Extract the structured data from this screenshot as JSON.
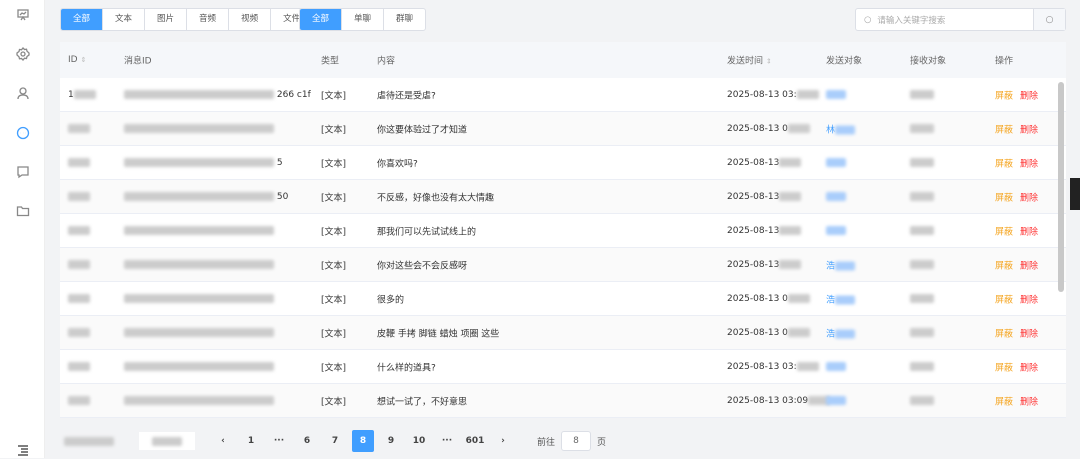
{
  "sidebar": {
    "icons": [
      "presentation-icon",
      "settings-icon",
      "user-icon",
      "chat-icon",
      "message-icon",
      "folder-icon",
      "menu-icon"
    ],
    "active": "chat-icon"
  },
  "filters": {
    "types": [
      "全部",
      "文本",
      "图片",
      "音频",
      "视频",
      "文件"
    ],
    "scopes": [
      "全部",
      "单聊",
      "群聊"
    ]
  },
  "search": {
    "placeholder": "请输入关键字搜索"
  },
  "table": {
    "headers": {
      "id": "ID",
      "msg_id": "消息ID",
      "type": "类型",
      "content": "内容",
      "time": "发送时间",
      "sender": "发送对象",
      "receiver": "接收对象",
      "actions": "操作"
    },
    "rows": [
      {
        "id": "1",
        "msg_id": "266 c1f",
        "type": "[文本]",
        "content": "虐待还是受虐?",
        "time": "2025-08-13 03:",
        "sender": "",
        "receiver": ""
      },
      {
        "id": "",
        "msg_id": "",
        "type": "[文本]",
        "content": "你这要体验过了才知道",
        "time": "2025-08-13 0",
        "sender": "林",
        "receiver": ""
      },
      {
        "id": "",
        "msg_id": "5",
        "type": "[文本]",
        "content": "你喜欢吗?",
        "time": "2025-08-13",
        "sender": "",
        "receiver": ""
      },
      {
        "id": "",
        "msg_id": "50",
        "type": "[文本]",
        "content": "不反感，好像也没有太大情趣",
        "time": "2025-08-13",
        "sender": "",
        "receiver": ""
      },
      {
        "id": "",
        "msg_id": "",
        "type": "[文本]",
        "content": "那我们可以先试试线上的",
        "time": "2025-08-13",
        "sender": "",
        "receiver": ""
      },
      {
        "id": "",
        "msg_id": "",
        "type": "[文本]",
        "content": "你对这些会不会反感呀",
        "time": "2025-08-13",
        "sender": "浩",
        "receiver": ""
      },
      {
        "id": "",
        "msg_id": "",
        "type": "[文本]",
        "content": "很多的",
        "time": "2025-08-13 0",
        "sender": "浩",
        "receiver": ""
      },
      {
        "id": "",
        "msg_id": "",
        "type": "[文本]",
        "content": "皮鞭 手拷 脚链 蜡烛 项圈 这些",
        "time": "2025-08-13 0",
        "sender": "浩",
        "receiver": ""
      },
      {
        "id": "",
        "msg_id": "",
        "type": "[文本]",
        "content": "什么样的道具?",
        "time": "2025-08-13 03:",
        "sender": "",
        "receiver": ""
      },
      {
        "id": "",
        "msg_id": "",
        "type": "[文本]",
        "content": "想试一试了，不好意思",
        "time": "2025-08-13 03:09",
        "sender": "",
        "receiver": ""
      }
    ],
    "action_block": "屏蔽",
    "action_delete": "删除"
  },
  "pagination": {
    "prev": "‹",
    "next": "›",
    "pages": [
      "1",
      "···",
      "6",
      "7",
      "8",
      "9",
      "10",
      "···",
      "601"
    ],
    "current": "8",
    "goto_label": "前往",
    "goto_value": "8",
    "goto_suffix": "页"
  },
  "colors": {
    "primary": "#409eff",
    "block": "#f5a623",
    "delete": "#ff3333"
  }
}
